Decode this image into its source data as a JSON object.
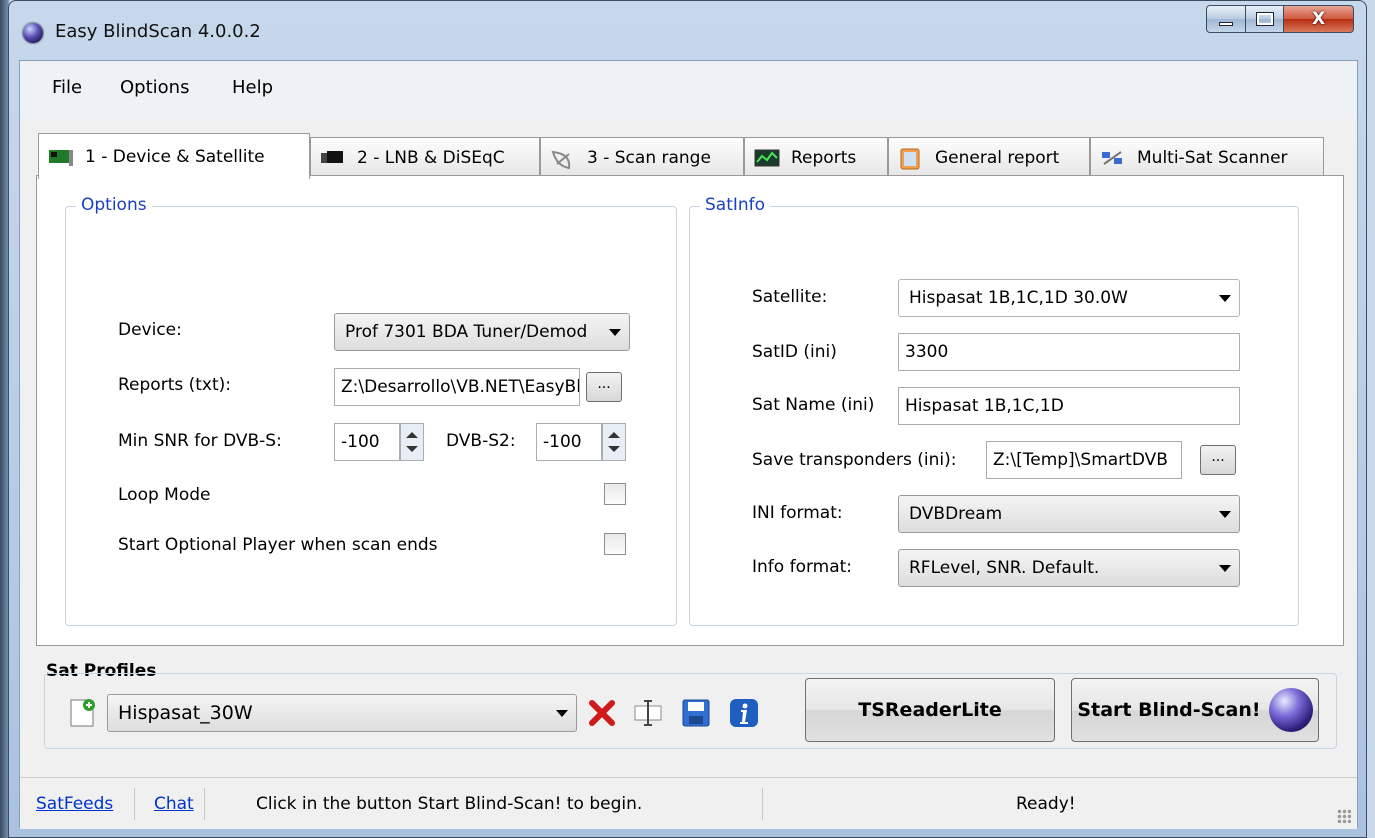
{
  "window": {
    "title": "Easy BlindScan 4.0.0.2",
    "close_glyph": "X"
  },
  "menu": [
    "File",
    "Options",
    "Help"
  ],
  "tabs": [
    {
      "label": "1 - Device & Satellite",
      "icon": "pci-card-icon",
      "active": true
    },
    {
      "label": "2 - LNB & DiSEqC",
      "icon": "lnb-icon"
    },
    {
      "label": "3 - Scan range",
      "icon": "satellite-dish-icon"
    },
    {
      "label": "Reports",
      "icon": "chart-monitor-icon"
    },
    {
      "label": "General report",
      "icon": "document-icon"
    },
    {
      "label": "Multi-Sat Scanner",
      "icon": "multi-satellite-icon"
    }
  ],
  "options": {
    "title": "Options",
    "device_label": "Device:",
    "device_value": "Prof 7301 BDA Tuner/Demod",
    "reports_label": "Reports (txt):",
    "reports_value": "Z:\\Desarrollo\\VB.NET\\EasyBlindScan",
    "browse": "...",
    "min_snr_label": "Min SNR for DVB-S:",
    "min_snr_value": "-100",
    "dvbs2_label": "DVB-S2:",
    "dvbs2_value": "-100",
    "loop_mode_label": "Loop Mode",
    "loop_mode_checked": false,
    "start_player_label": "Start Optional Player when scan ends",
    "start_player_checked": false
  },
  "satinfo": {
    "title": "SatInfo",
    "satellite_label": "Satellite:",
    "satellite_value": "Hispasat 1B,1C,1D 30.0W",
    "satid_label": "SatID (ini)",
    "satid_value": "3300",
    "satname_label": "Sat Name (ini)",
    "satname_value": "Hispasat 1B,1C,1D",
    "save_label": "Save transponders (ini):",
    "save_value": "Z:\\[Temp]\\SmartDVB",
    "browse": "...",
    "ini_format_label": "INI format:",
    "ini_format_value": "DVBDream",
    "info_format_label": "Info format:",
    "info_format_value": "RFLevel, SNR. Default."
  },
  "profiles": {
    "title": "Sat Profiles",
    "selected": "Hispasat_30W",
    "tsreader_label": "TSReaderLite",
    "start_label": "Start Blind-Scan!"
  },
  "status": {
    "link1": "SatFeeds",
    "link2": "Chat",
    "message": "Click in the button Start Blind-Scan! to begin.",
    "state": "Ready!"
  },
  "colors": {
    "group_title": "#1a3fbf",
    "link": "#0033cc",
    "delete_red": "#d11a1a",
    "info_blue": "#1e5fbf"
  }
}
